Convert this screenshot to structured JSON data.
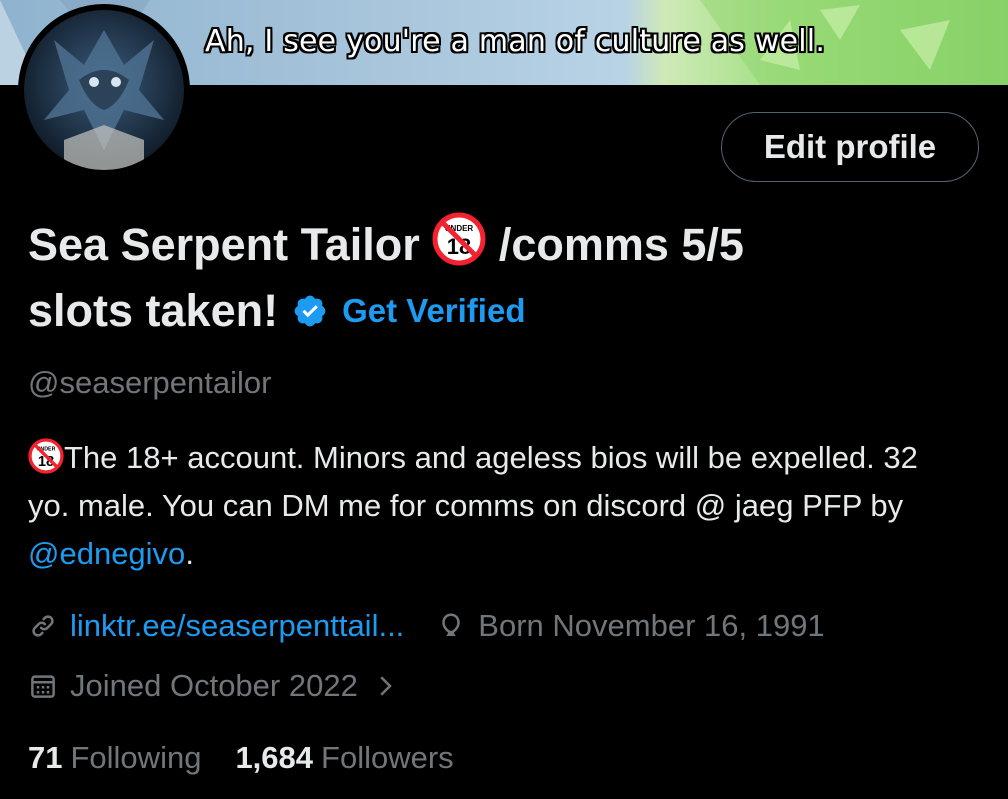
{
  "banner": {
    "caption": "Ah, I see you're a man of culture as well."
  },
  "profile": {
    "edit_label": "Edit profile",
    "name_line1": "Sea Serpent Tailor",
    "name_after_badge": " /comms 5/5",
    "name_line2": "slots taken!",
    "get_verified": "Get Verified",
    "handle": "@seaserpentailor",
    "bio_text": "The 18+ account. Minors and ageless bios will be expelled. 32 yo. male. You can DM me for comms on discord @ jaeg PFP by ",
    "bio_mention": "@ednegivo",
    "bio_end": ".",
    "website": "linktr.ee/seaserpenttail...",
    "birthday": "Born November 16, 1991",
    "joined": "Joined October 2022",
    "following_count": "71",
    "following_label": "Following",
    "followers_count": "1,684",
    "followers_label": "Followers"
  },
  "icons": {
    "badge": "under-18-icon",
    "verified": "verified-badge-icon",
    "link": "link-icon",
    "birthday": "balloon-icon",
    "joined": "calendar-icon",
    "chevron": "chevron-right-icon"
  },
  "colors": {
    "accent": "#1d9bf0",
    "muted": "#71767b",
    "text": "#e7e9ea",
    "background": "#000000"
  }
}
